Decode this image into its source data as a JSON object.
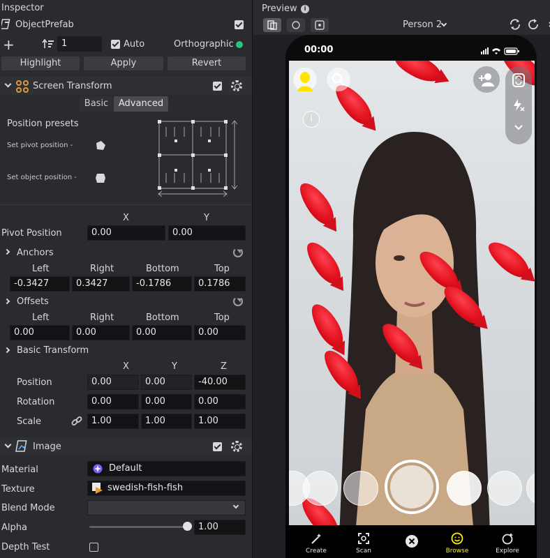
{
  "inspector": {
    "title": "Inspector",
    "object_name": "ObjectPrefab",
    "layer_value": "1",
    "auto_label": "Auto",
    "projection_label": "Orthographic",
    "buttons": {
      "highlight": "Highlight",
      "apply": "Apply",
      "revert": "Revert"
    },
    "screen_transform": {
      "title": "Screen Transform",
      "tabs": [
        "Basic",
        "Advanced"
      ],
      "active_tab": "Advanced",
      "position_presets_label": "Position presets",
      "set_pivot_label": "Set pivot position -",
      "set_object_label": "Set object position -",
      "xy_headers": [
        "X",
        "Y"
      ],
      "pivot_label": "Pivot Position",
      "pivot": [
        "0.00",
        "0.00"
      ],
      "anchors_label": "Anchors",
      "edge_headers": [
        "Left",
        "Right",
        "Bottom",
        "Top"
      ],
      "anchors": [
        "-0.3427",
        "0.3427",
        "-0.1786",
        "0.1786"
      ],
      "offsets_label": "Offsets",
      "offsets": [
        "0.00",
        "0.00",
        "0.00",
        "0.00"
      ]
    },
    "basic_transform": {
      "title": "Basic Transform",
      "xyz_headers": [
        "X",
        "Y",
        "Z"
      ],
      "position_label": "Position",
      "position": [
        "0.00",
        "0.00",
        "-40.00"
      ],
      "rotation_label": "Rotation",
      "rotation": [
        "0.00",
        "0.00",
        "0.00"
      ],
      "scale_label": "Scale",
      "scale": [
        "1.00",
        "1.00",
        "1.00"
      ]
    },
    "image": {
      "title": "Image",
      "material_label": "Material",
      "material_value": "Default",
      "texture_label": "Texture",
      "texture_value": "swedish-fish-fish",
      "blend_mode_label": "Blend Mode",
      "blend_mode_value": "",
      "alpha_label": "Alpha",
      "alpha_value": "1.00",
      "alpha_fraction": 1.0,
      "depth_test_label": "Depth Test"
    }
  },
  "preview": {
    "title": "Preview",
    "person_selector": "Person 2",
    "time": "00:00",
    "tabs": [
      "Create",
      "Scan",
      "",
      "Browse",
      "Explore"
    ],
    "active_tab": "Browse",
    "accent_color": "#fff200"
  }
}
